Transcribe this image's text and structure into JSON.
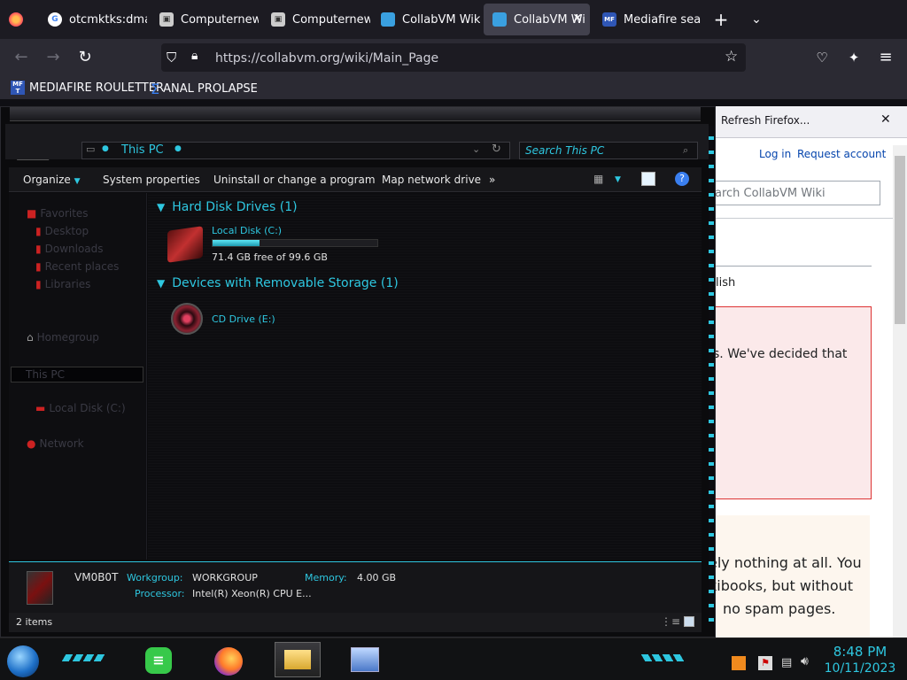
{
  "browser": {
    "tabs": [
      {
        "label": "otcmktks:dman",
        "icon": "google-icon"
      },
      {
        "label": "Computernewb",
        "icon": "computer-icon"
      },
      {
        "label": "Computernewb",
        "icon": "computer-icon"
      },
      {
        "label": "CollabVM Wiki",
        "icon": "monitor-icon"
      },
      {
        "label": "CollabVM Wi",
        "icon": "monitor-icon",
        "active": true
      },
      {
        "label": "Mediafire searc",
        "icon": "mediafire-icon"
      }
    ],
    "url": "https://collabvm.org/wiki/Main_Page",
    "bookmarks": [
      {
        "label": "MEDIAFIRE ROULETTER",
        "icon": "MF T"
      },
      {
        "label": "ANAL PROLAPSE",
        "icon": "sigma"
      }
    ]
  },
  "wiki": {
    "refresh_label": "Refresh Firefox...",
    "login": "Log in",
    "request_account": "Request account",
    "search_placeholder": "arch CollabVM Wiki",
    "lang_fragment": "lish",
    "notice_fragment": "s. We've decided that",
    "body_lines": [
      "ely nothing at all. You",
      "kibooks, but without",
      "no spam pages."
    ]
  },
  "explorer": {
    "address": "This PC",
    "search_placeholder": "Search This PC",
    "commands": [
      "Organize",
      "System properties",
      "Uninstall or change a program",
      "Map network drive"
    ],
    "more_symbol": "»",
    "groups": {
      "hard_disks": "Hard Disk Drives (1)",
      "removable": "Devices with Removable Storage (1)"
    },
    "local_disk": {
      "name": "Local Disk (C:)",
      "free_text": "71.4 GB free of 99.6 GB",
      "used_fraction": 0.283
    },
    "cd_drive": {
      "name": "CD Drive (E:)"
    },
    "nav_items": [
      "Favorites",
      "Desktop",
      "Downloads",
      "Recent places",
      "Libraries",
      "Homegroup",
      "This PC",
      "Local Disk (C:)",
      "Network"
    ],
    "details": {
      "computer_name": "VM0B0T",
      "workgroup_label": "Workgroup:",
      "workgroup_value": "WORKGROUP",
      "memory_label": "Memory:",
      "memory_value": "4.00 GB",
      "processor_label": "Processor:",
      "processor_value": "Intel(R) Xeon(R) CPU E..."
    },
    "status_items": "2 items"
  },
  "taskbar": {
    "time": "8:48 PM",
    "date": "10/11/2023"
  },
  "colors": {
    "accent": "#2ec7e0",
    "firefox_bg": "#1c1b22"
  }
}
